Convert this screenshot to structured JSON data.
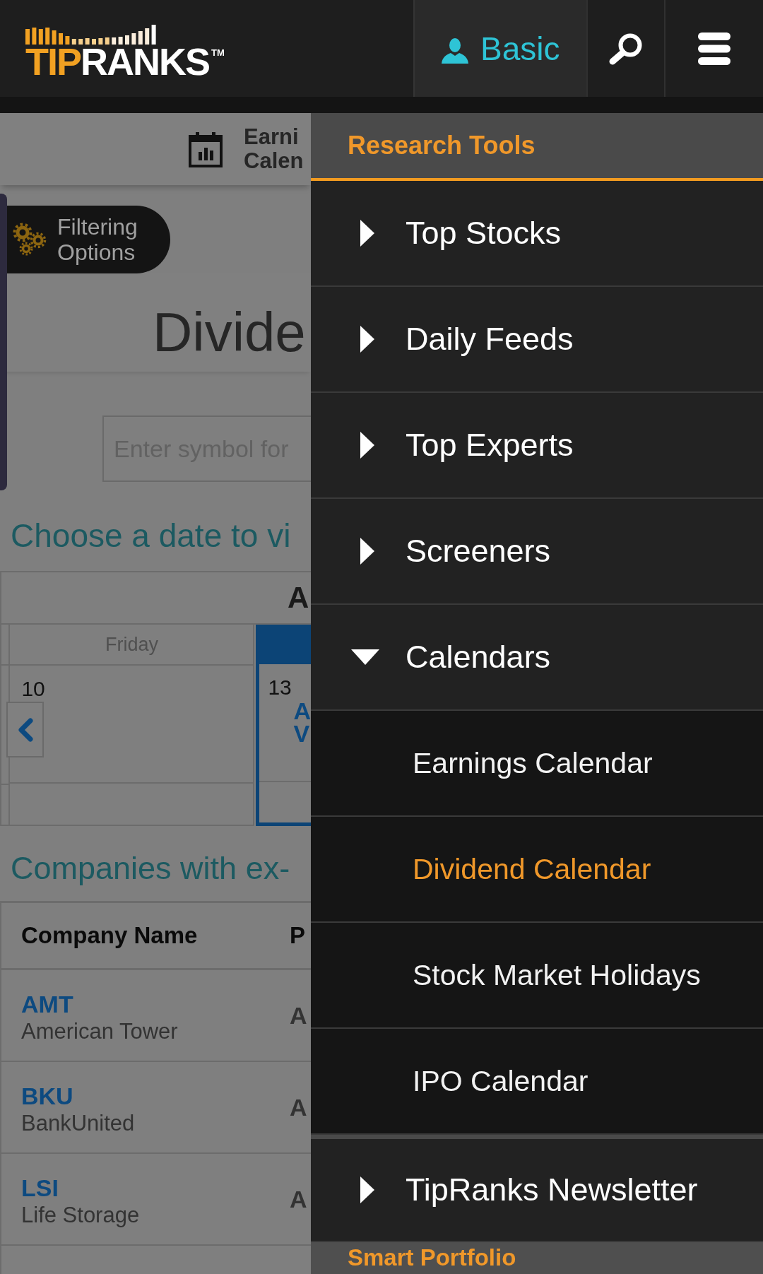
{
  "header": {
    "logo": {
      "accent": "TIP",
      "rest": "RANKS",
      "trademark": "TM"
    },
    "account": "Basic"
  },
  "subnav": {
    "lines": [
      "Earni",
      "Calen"
    ]
  },
  "filter_button": "Filtering Options",
  "page_title": "Divide",
  "search": {
    "placeholder": "Enter symbol for"
  },
  "date_prompt": "Choose a date to vi",
  "calendar": {
    "month": "A",
    "days": [
      {
        "weekday": "Friday",
        "date": "10",
        "selected": false
      },
      {
        "date": "13",
        "selected": true,
        "entries": [
          "A",
          "V"
        ]
      }
    ]
  },
  "companies_heading": "Companies with ex-",
  "table": {
    "columns": [
      "Company Name",
      "P"
    ],
    "rows": [
      {
        "ticker": "AMT",
        "name": "American Tower",
        "column_2": "A"
      },
      {
        "ticker": "BKU",
        "name": "BankUnited",
        "column_2": "A"
      },
      {
        "ticker": "LSI",
        "name": "Life Storage",
        "column_2": "A"
      }
    ]
  },
  "menu": {
    "sections": [
      {
        "title": "Research Tools",
        "items": [
          {
            "label": "Top Stocks",
            "expanded": false
          },
          {
            "label": "Daily Feeds",
            "expanded": false
          },
          {
            "label": "Top Experts",
            "expanded": false
          },
          {
            "label": "Screeners",
            "expanded": false
          },
          {
            "label": "Calendars",
            "expanded": true,
            "children": [
              {
                "label": "Earnings Calendar",
                "selected": false
              },
              {
                "label": "Dividend Calendar",
                "selected": true
              },
              {
                "label": "Stock Market Holidays",
                "selected": false
              },
              {
                "label": "IPO Calendar",
                "selected": false
              }
            ]
          },
          {
            "label": "TipRanks Newsletter",
            "expanded": false
          }
        ]
      },
      {
        "title": "Smart Portfolio"
      }
    ]
  }
}
